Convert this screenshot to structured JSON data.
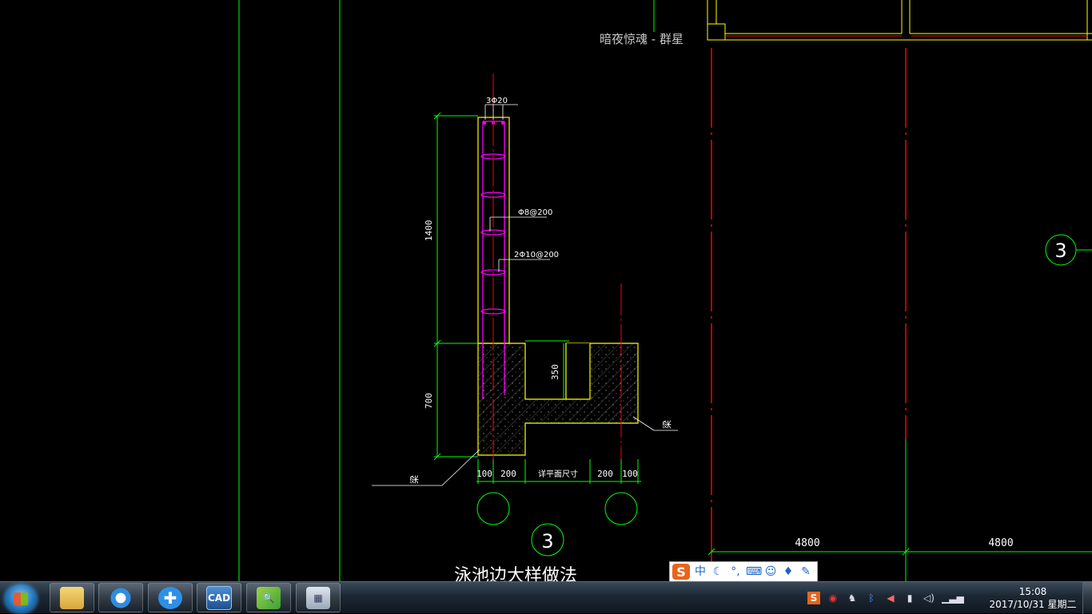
{
  "overlay_title": "暗夜惊魂 - 群星",
  "drawing": {
    "rebar_top_label": "3Φ20",
    "stirrup_label_1": "Φ8@200",
    "stirrup_label_2": "2Φ10@200",
    "dim_wall_height": "1400",
    "dim_base_height": "700",
    "dim_pit_depth": "350",
    "dim_bottom_1": "100",
    "dim_bottom_2": "200",
    "dim_bottom_mid": "详平面尺寸",
    "dim_bottom_3": "200",
    "dim_bottom_4": "100",
    "leader_label_left": "梁",
    "leader_label_right": "梁",
    "section_marker": "3",
    "axis_marker_right": "3",
    "caption": "泳池边大样做法",
    "dim_span_1": "4800",
    "dim_span_2": "4800"
  },
  "ime": {
    "logo": "S",
    "mode": "中",
    "items": [
      "moon-icon",
      "punctuation-icon",
      "keyboard-icon",
      "user-icon",
      "skin-icon",
      "wrench-icon"
    ]
  },
  "taskbar": {
    "apps": [
      {
        "name": "file-explorer",
        "label": ""
      },
      {
        "name": "qq-browser",
        "label": ""
      },
      {
        "name": "app-plus",
        "label": ""
      },
      {
        "name": "cad-app",
        "label": "CAD"
      },
      {
        "name": "image-viewer",
        "label": ""
      },
      {
        "name": "calculator",
        "label": ""
      }
    ],
    "clock_time": "15:08",
    "clock_date": "2017/10/31 星期二"
  },
  "colors": {
    "green": "#00ff00",
    "red": "#ff0000",
    "yellow": "#ffff00",
    "magenta": "#ff00ff",
    "white": "#ffffff"
  }
}
